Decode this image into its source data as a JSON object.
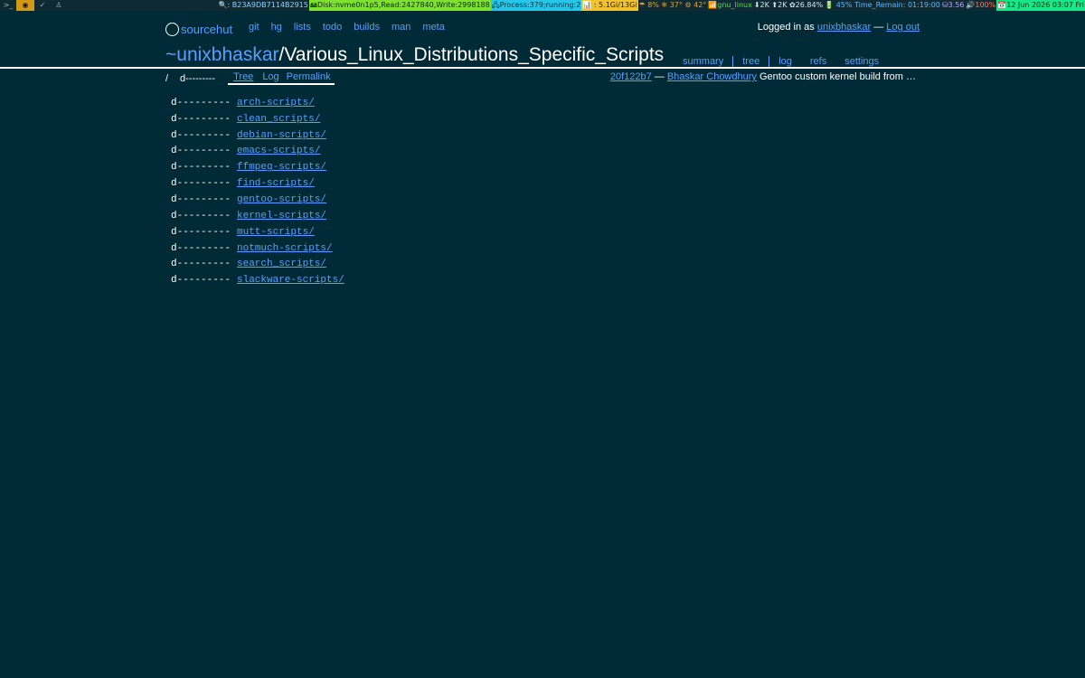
{
  "statusbar": {
    "workspaces": [
      ">_",
      "◉",
      "✓",
      "♙"
    ],
    "segments": [
      {
        "cls": "seg-id",
        "text": "🔍: B23A9DB7114B2915"
      },
      {
        "cls": "seg-disk",
        "text": "🖴Disk:nvme0n1p5,Read:2427840,Write:2998188"
      },
      {
        "cls": "seg-proc",
        "text": "🖧Process:379;running:2"
      },
      {
        "cls": "seg-mem",
        "text": "📊 : 5.1Gi/13Gi"
      },
      {
        "cls": "seg-temp",
        "text": "☂ 8% ❄ 37° ⚙ 42°"
      },
      {
        "cls": "seg-net",
        "text": "📶gnu_linux"
      },
      {
        "cls": "seg-speed",
        "text": "⬇2K ⬆2K ✿26.84%"
      },
      {
        "cls": "seg-bat",
        "text": "🔋 45% Time_Remain: 01:19:00"
      },
      {
        "cls": "seg-load",
        "text": "⛁3.56"
      },
      {
        "cls": "seg-vol",
        "text": "🔊100%"
      },
      {
        "cls": "seg-date",
        "text": "📅12 Jun 2026 03:07 Fri"
      }
    ]
  },
  "header": {
    "logo_text": "sourcehut",
    "nav": [
      "git",
      "hg",
      "lists",
      "todo",
      "builds",
      "man",
      "meta"
    ],
    "login_prefix": "Logged in as",
    "username": "unixbhaskar",
    "separator": "—",
    "logout": "Log out"
  },
  "repo": {
    "owner": "~unixbhaskar",
    "name": "/Various_Linux_Distributions_Specific_Scripts",
    "tabs": [
      "summary",
      "tree",
      "log",
      "refs",
      "settings"
    ],
    "active_tab": "tree"
  },
  "subbar": {
    "path": "/",
    "mode": "d---------",
    "tabs": [
      "Tree",
      "Log",
      "Permalink"
    ],
    "active": "Tree"
  },
  "commit": {
    "hash": "20f122b7",
    "dash": "—",
    "author": "Bhaskar Chowdhury",
    "message": "Gentoo custom kernel build from …"
  },
  "tree": [
    {
      "mode": "d---------",
      "name": "arch-scripts/"
    },
    {
      "mode": "d---------",
      "name": "clean_scripts/"
    },
    {
      "mode": "d---------",
      "name": "debian-scripts/"
    },
    {
      "mode": "d---------",
      "name": "emacs-scripts/"
    },
    {
      "mode": "d---------",
      "name": "ffmpeg-scripts/"
    },
    {
      "mode": "d---------",
      "name": "find-scripts/"
    },
    {
      "mode": "d---------",
      "name": "gentoo-scripts/"
    },
    {
      "mode": "d---------",
      "name": "kernel-scripts/"
    },
    {
      "mode": "d---------",
      "name": "mutt-scripts/"
    },
    {
      "mode": "d---------",
      "name": "notmuch-scripts/"
    },
    {
      "mode": "d---------",
      "name": "search_scripts/"
    },
    {
      "mode": "d---------",
      "name": "slackware-scripts/"
    }
  ]
}
